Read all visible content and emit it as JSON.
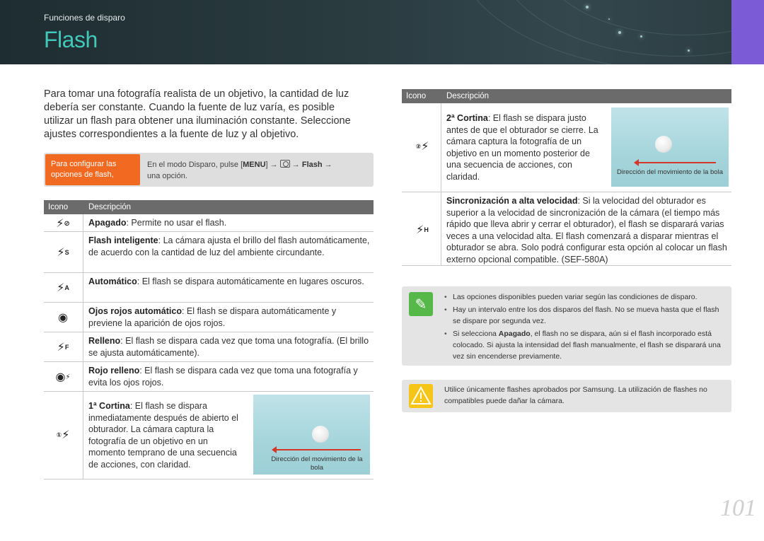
{
  "header": {
    "section": "Funciones de disparo",
    "title": "Flash"
  },
  "intro": "Para tomar una fotografía realista de un objetivo, la cantidad de luz debería ser constante. Cuando la fuente de luz varía, es posible utilizar un flash para obtener una iluminación constante. Seleccione ajustes correspondientes a la fuente de luz y al objetivo.",
  "howto": {
    "badge": "Para configurar las opciones de flash,",
    "text_pre": "En el modo Disparo, pulse [",
    "menu": "MENU",
    "text_mid": "] →",
    "arrow2": "→",
    "flash": "Flash",
    "arrow3": "→",
    "text_post": "una opción."
  },
  "left_table": {
    "col_icon": "Icono",
    "col_desc": "Descripción",
    "rows": [
      {
        "icon_name": "flash-off-icon",
        "glyph": "⚡",
        "term": "Apagado",
        "text": ": Permite no usar el flash."
      },
      {
        "icon_name": "smart-flash-icon",
        "glyph": "⚡",
        "term": "Flash inteligente",
        "text": ": La cámara ajusta el brillo del flash automáticamente, de acuerdo con la cantidad de luz del ambiente circundante."
      },
      {
        "icon_name": "auto-flash-icon",
        "glyph": "⚡",
        "term": "Automático",
        "text": ": El flash se dispara automáticamente en lugares oscuros."
      },
      {
        "icon_name": "red-eye-icon",
        "glyph": "◉",
        "term": "Ojos rojos automático",
        "text": ": El flash se dispara automáticamente y previene la aparición de ojos rojos."
      },
      {
        "icon_name": "fill-flash-icon",
        "glyph": "⚡",
        "term": "Relleno",
        "text": ": El flash se dispara cada vez que toma una fotografía. (El brillo se ajusta automáticamente)."
      },
      {
        "icon_name": "red-eye-fill-icon",
        "glyph": "◉",
        "term": "Rojo relleno",
        "text": ": El flash se dispara cada vez que toma una fotografía y evita los ojos rojos."
      },
      {
        "icon_name": "first-curtain-icon",
        "glyph": "⚡",
        "term": "1ª Cortina",
        "text": ": El flash se dispara inmediatamente después de abierto el obturador. La cámara captura la fotografía de un objetivo en un momento temprano de una secuencia de acciones, con claridad.",
        "caption": "Dirección del movimiento de la bola"
      }
    ]
  },
  "right_table": {
    "col_icon": "Icono",
    "col_desc": "Descripción",
    "rows": [
      {
        "icon_name": "second-curtain-icon",
        "glyph": "⚡",
        "term": "2ª Cortina",
        "text": ": El flash se dispara justo antes de que el obturador se cierre. La cámara captura la fotografía de un objetivo en un momento posterior de una secuencia de acciones, con claridad.",
        "caption": "Dirección del movimiento de la bola"
      },
      {
        "icon_name": "high-speed-sync-icon",
        "glyph": "⚡",
        "term": "Sincronización a alta velocidad",
        "text": ": Si la velocidad del obturador es superior a la velocidad de sincronización de la cámara (el tiempo más rápido que lleva abrir y cerrar el obturador), el flash se disparará varias veces a una velocidad alta. El flash comenzará a disparar mientras el obturador se abra. Solo podrá configurar esta opción al colocar un flash externo opcional compatible. (SEF-580A)"
      }
    ]
  },
  "note": {
    "items": [
      {
        "text": "Las opciones disponibles pueden variar según las condiciones de disparo."
      },
      {
        "text": "Hay un intervalo entre los dos disparos del flash. No se mueva hasta que el flash se dispare por segunda vez."
      },
      {
        "pre": "Si selecciona ",
        "bold": "Apagado",
        "post": ", el flash no se dispara, aún si el flash incorporado está colocado. Si ajusta la intensidad del flash manualmente, el flash se disparará una vez sin encenderse previamente."
      }
    ]
  },
  "warning": {
    "text": "Utilice únicamente flashes aprobados por Samsung. La utilización de flashes no compatibles puede dañar la cámara."
  },
  "page_number": "101",
  "colors": {
    "title": "#43c7b8",
    "badge": "#f26a21",
    "side_tab": "#7b5bd6",
    "note_icon": "#57b84a",
    "warning_icon": "#f5c518",
    "arrow": "#d6362a"
  }
}
